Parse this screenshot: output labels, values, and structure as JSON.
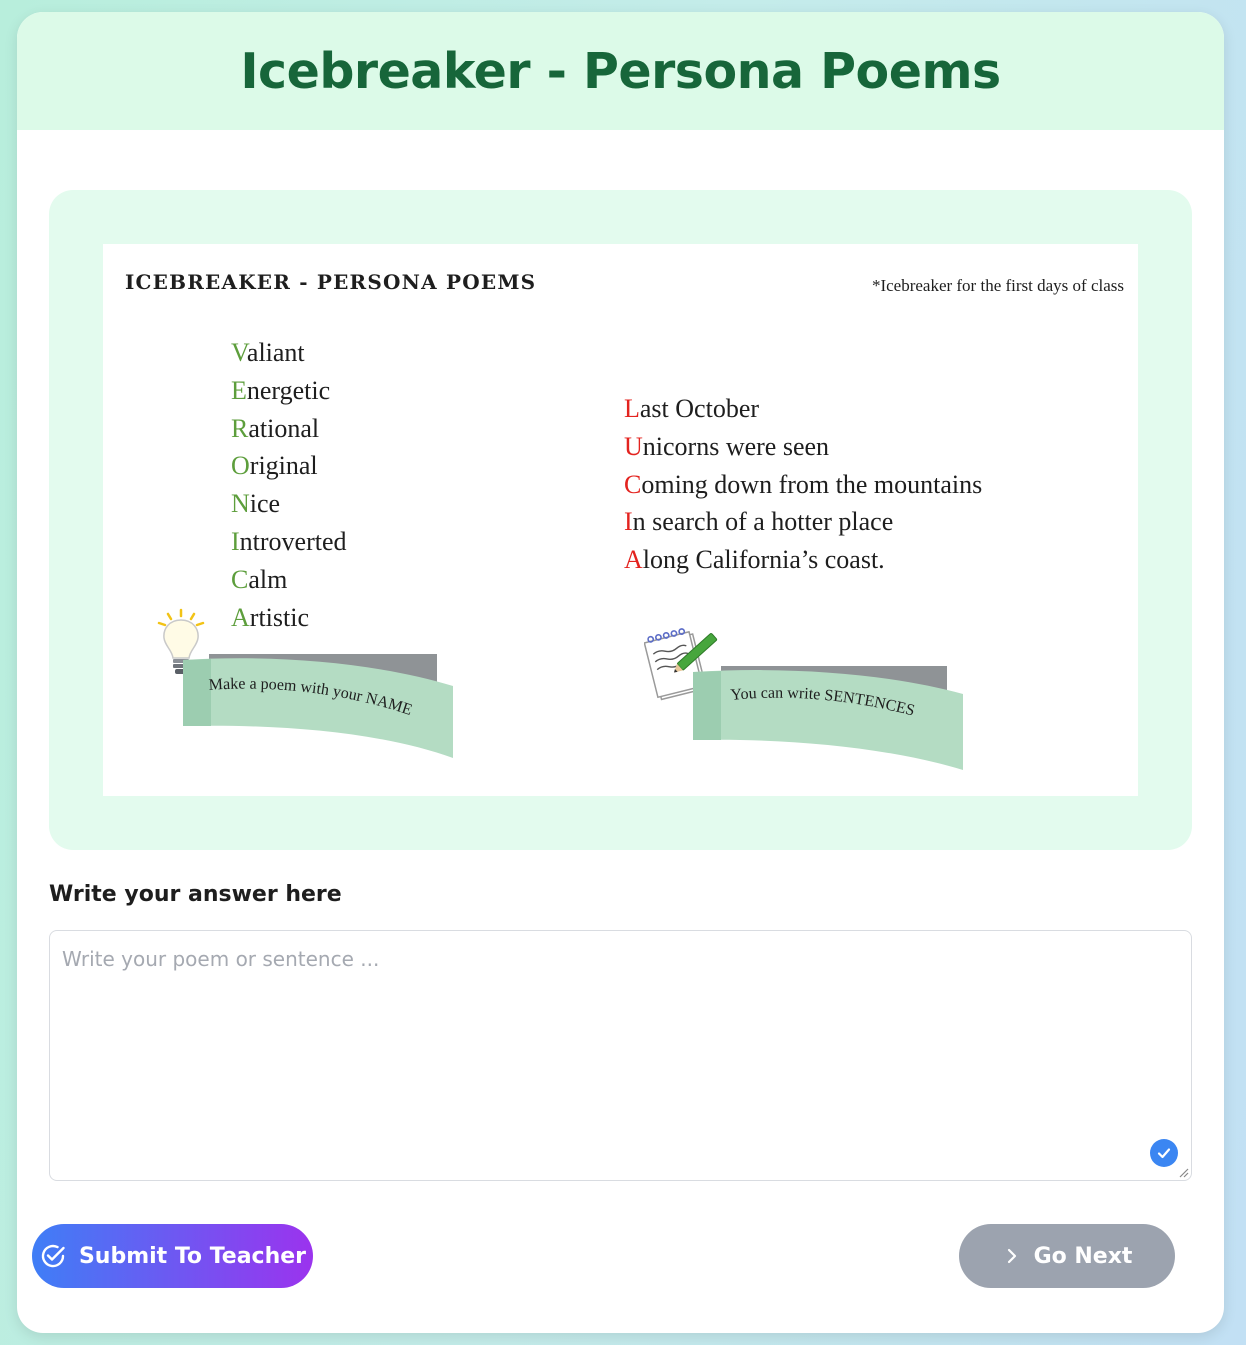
{
  "header": {
    "title": "Icebreaker - Persona Poems"
  },
  "worksheet": {
    "title": "ICEBREAKER - PERSONA POEMS",
    "note": "*Icebreaker for the first days of class",
    "name_poem": [
      {
        "initial": "V",
        "rest": "aliant"
      },
      {
        "initial": "E",
        "rest": "nergetic"
      },
      {
        "initial": "R",
        "rest": "ational"
      },
      {
        "initial": "O",
        "rest": "riginal"
      },
      {
        "initial": "N",
        "rest": "ice"
      },
      {
        "initial": "I",
        "rest": "ntroverted"
      },
      {
        "initial": "C",
        "rest": "alm"
      },
      {
        "initial": "A",
        "rest": "rtistic"
      }
    ],
    "sentence_poem": [
      {
        "initial": "L",
        "rest": "ast October"
      },
      {
        "initial": "U",
        "rest": "nicorns were seen"
      },
      {
        "initial": "C",
        "rest": "oming down from the mountains"
      },
      {
        "initial": "I",
        "rest": "n search of a hotter place"
      },
      {
        "initial": "A",
        "rest": "long California’s coast."
      }
    ],
    "tip_name": "Make a poem with your NAME",
    "tip_sentences": "You can write SENTENCES",
    "name_initial_color": "#5d9e3c",
    "sentence_initial_color": "#e3231f"
  },
  "answer": {
    "label": "Write your answer here",
    "placeholder": "Write your poem or sentence ...",
    "value": ""
  },
  "actions": {
    "submit_label": "Submit To Teacher",
    "next_label": "Go Next"
  },
  "icons": {
    "submit": "check-circle-icon",
    "next": "chevron-right-icon",
    "field_status": "check-badge-icon",
    "tip_name": "lightbulb-icon",
    "tip_sentences": "notepad-pencil-icon"
  },
  "colors": {
    "header_bg": "#dcfae8",
    "title": "#17663a",
    "panel_bg": "#e3fbee",
    "submit_gradient_start": "#3f7ef6",
    "submit_gradient_end": "#9b33ee",
    "next_disabled": "#9ca3af"
  }
}
